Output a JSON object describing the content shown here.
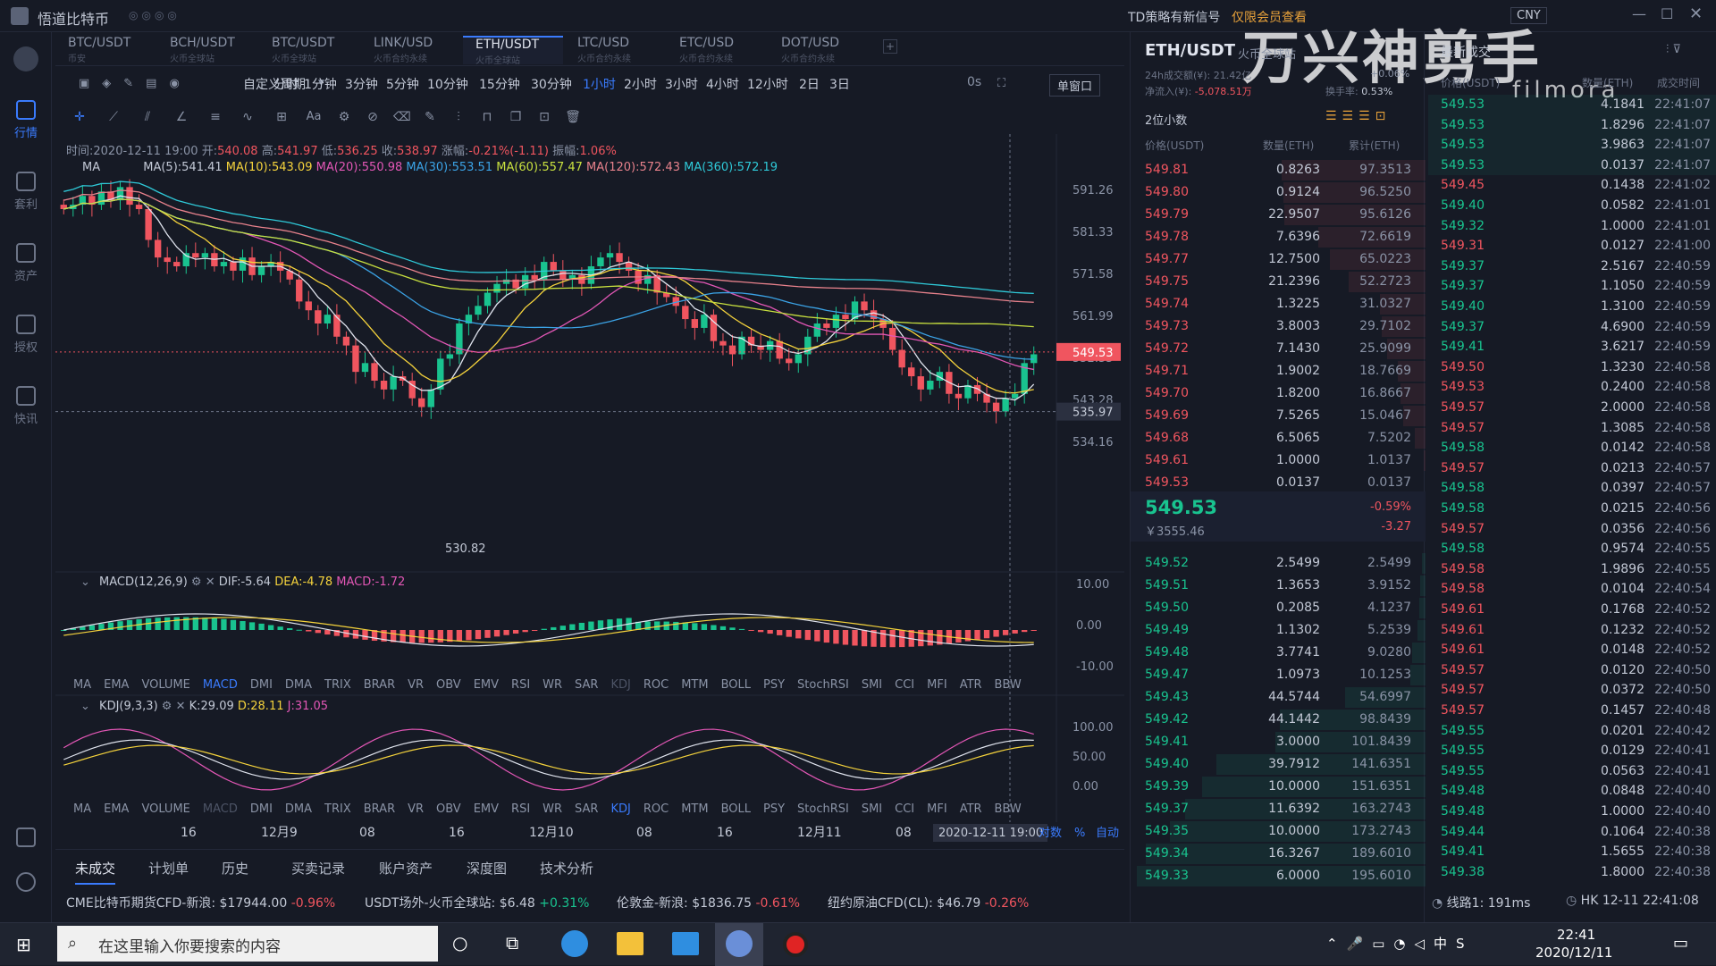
{
  "app": {
    "title": "悟道比特币",
    "notice": "TD策略有新信号",
    "notice_link": "仅限会员查看",
    "currency": "CNY"
  },
  "nav": [
    {
      "label": "行情",
      "icon": "market-icon",
      "active": true
    },
    {
      "label": "套利",
      "icon": "arbitrage-icon"
    },
    {
      "label": "资产",
      "icon": "wallet-icon"
    },
    {
      "label": "授权",
      "icon": "auth-icon"
    },
    {
      "label": "快讯",
      "icon": "news-icon"
    }
  ],
  "tabs": [
    {
      "pair": "BTC/USDT",
      "sub": "币安"
    },
    {
      "pair": "BCH/USDT",
      "sub": "火币全球站"
    },
    {
      "pair": "BTC/USDT",
      "sub": "火币全球站"
    },
    {
      "pair": "LINK/USD",
      "sub": "火币合约永续"
    },
    {
      "pair": "ETH/USDT",
      "sub": "火币全球站",
      "active": true
    },
    {
      "pair": "LTC/USD",
      "sub": "火币合约永续"
    },
    {
      "pair": "ETC/USD",
      "sub": "火币合约永续"
    },
    {
      "pair": "DOT/USD",
      "sub": "火币合约永续"
    }
  ],
  "periods": {
    "custom": "自定义周期",
    "items": [
      "分时",
      "1分钟",
      "3分钟",
      "5分钟",
      "10分钟",
      "15分钟",
      "30分钟",
      "1小时",
      "2小时",
      "3小时",
      "4小时",
      "12小时",
      "2日",
      "3日"
    ],
    "active": "1小时",
    "right_label": "0s",
    "window": "单窗口"
  },
  "info": {
    "time_label": "时间:",
    "time": "2020-12-11 19:00",
    "open_label": "开:",
    "open": "540.08",
    "high_label": "高:",
    "high": "541.97",
    "low_label": "低:",
    "low": "536.25",
    "close_label": "收:",
    "close": "538.97",
    "chg_label": "涨幅:",
    "chg": "-0.21%(-1.11)",
    "amp_label": "振幅:",
    "amp": "1.06%"
  },
  "ma": {
    "label": "MA",
    "ma5": "MA(5):541.41",
    "ma10": "MA(10):543.09",
    "ma20": "MA(20):550.98",
    "ma30": "MA(30):553.51",
    "ma60": "MA(60):557.47",
    "ma120": "MA(120):572.43",
    "ma360": "MA(360):572.19"
  },
  "price_axis": [
    "591.26",
    "581.33",
    "571.58",
    "561.99",
    "552.55",
    "543.28",
    "534.16"
  ],
  "last_price_tag": "549.53",
  "cross_price_tag": "535.97",
  "low_marker": "530.82",
  "macd": {
    "label": "MACD(12,26,9)",
    "dif": "DIF:-5.64",
    "dea": "DEA:-4.78",
    "macd": "MACD:-1.72",
    "axis": [
      "10.00",
      "0.00",
      "-10.00"
    ]
  },
  "kdj": {
    "label": "KDJ(9,3,3)",
    "k": "K:29.09",
    "d": "D:28.11",
    "j": "J:31.05",
    "axis": [
      "100.00",
      "50.00",
      "0.00"
    ]
  },
  "indicators": [
    "MA",
    "EMA",
    "VOLUME",
    "MACD",
    "DMI",
    "DMA",
    "TRIX",
    "BRAR",
    "VR",
    "OBV",
    "EMV",
    "RSI",
    "WR",
    "SAR",
    "KDJ",
    "ROC",
    "MTM",
    "BOLL",
    "PSY",
    "StochRSI",
    "SMI",
    "CCI",
    "MFI",
    "ATR",
    "BBW"
  ],
  "time_axis": [
    "16",
    "12月9",
    "08",
    "16",
    "12月10",
    "08",
    "16",
    "12月11",
    "08"
  ],
  "time_cursor": "2020-12-11 19:00",
  "axis_opts": [
    "对数",
    "%",
    "自动"
  ],
  "bottom_tabs": [
    "未成交",
    "计划单",
    "历史",
    "买卖记录",
    "账户资产",
    "深度图",
    "技术分析"
  ],
  "ticker": [
    {
      "name": "CME比特币期货CFD-新浪:",
      "price": "$17944.00",
      "chg": "-0.96%"
    },
    {
      "name": "USDT场外-火币全球站:",
      "price": "$6.48",
      "chg": "+0.31%"
    },
    {
      "name": "伦敦金-新浪:",
      "price": "$1836.75",
      "chg": "-0.61%"
    },
    {
      "name": "纽约原油CFD(CL):",
      "price": "$46.79",
      "chg": "-0.26%"
    }
  ],
  "status": {
    "line": "线路1: 191ms",
    "clock": "HK 12-11 22:41:08"
  },
  "summary": {
    "pair": "ETH/USDT",
    "exchange": "火币全球站",
    "vol_label": "24h成交额(¥):",
    "vol": "21.42亿",
    "inflow_label": "净流入(¥):",
    "inflow": "-5,078.51万",
    "chg": "+0.06%",
    "turnover_label": "换手率:",
    "turnover": "0.53%"
  },
  "orderbook": {
    "decimals": "2位小数",
    "headers": [
      "价格(USDT)",
      "数量(ETH)",
      "累计(ETH)"
    ],
    "asks": [
      [
        "549.81",
        "0.8263",
        "97.3513"
      ],
      [
        "549.80",
        "0.9124",
        "96.5250"
      ],
      [
        "549.79",
        "22.9507",
        "95.6126"
      ],
      [
        "549.78",
        "7.6396",
        "72.6619"
      ],
      [
        "549.77",
        "12.7500",
        "65.0223"
      ],
      [
        "549.75",
        "21.2396",
        "52.2723"
      ],
      [
        "549.74",
        "1.3225",
        "31.0327"
      ],
      [
        "549.73",
        "3.8003",
        "29.7102"
      ],
      [
        "549.72",
        "7.1430",
        "25.9099"
      ],
      [
        "549.71",
        "1.9002",
        "18.7669"
      ],
      [
        "549.70",
        "1.8200",
        "16.8667"
      ],
      [
        "549.69",
        "7.5265",
        "15.0467"
      ],
      [
        "549.68",
        "6.5065",
        "7.5202"
      ],
      [
        "549.61",
        "1.0000",
        "1.0137"
      ],
      [
        "549.53",
        "0.0137",
        "0.0137"
      ]
    ],
    "mid_price": "549.53",
    "mid_cny": "￥3555.46",
    "mid_chg": "-0.59%",
    "mid_diff": "-3.27",
    "bids": [
      [
        "549.52",
        "2.5499",
        "2.5499"
      ],
      [
        "549.51",
        "1.3653",
        "3.9152"
      ],
      [
        "549.50",
        "0.2085",
        "4.1237"
      ],
      [
        "549.49",
        "1.1302",
        "5.2539"
      ],
      [
        "549.48",
        "3.7741",
        "9.0280"
      ],
      [
        "549.47",
        "1.0973",
        "10.1253"
      ],
      [
        "549.43",
        "44.5744",
        "54.6997"
      ],
      [
        "549.42",
        "44.1442",
        "98.8439"
      ],
      [
        "549.41",
        "3.0000",
        "101.8439"
      ],
      [
        "549.40",
        "39.7912",
        "141.6351"
      ],
      [
        "549.39",
        "10.0000",
        "151.6351"
      ],
      [
        "549.37",
        "11.6392",
        "163.2743"
      ],
      [
        "549.35",
        "10.0000",
        "173.2743"
      ],
      [
        "549.34",
        "16.3267",
        "189.6010"
      ],
      [
        "549.33",
        "6.0000",
        "195.6010"
      ]
    ]
  },
  "trades": {
    "title": "最新成交",
    "headers": [
      "价格(USDT)",
      "数量(ETH)",
      "成交时间"
    ],
    "rows": [
      [
        "549.53",
        "4.1841",
        "22:41:07",
        "g"
      ],
      [
        "549.53",
        "1.8296",
        "22:41:07",
        "g"
      ],
      [
        "549.53",
        "3.9863",
        "22:41:07",
        "g"
      ],
      [
        "549.53",
        "0.0137",
        "22:41:07",
        "g"
      ],
      [
        "549.45",
        "0.1438",
        "22:41:02",
        "r"
      ],
      [
        "549.40",
        "0.0582",
        "22:41:01",
        "g"
      ],
      [
        "549.32",
        "1.0000",
        "22:41:01",
        "g"
      ],
      [
        "549.31",
        "0.0127",
        "22:41:00",
        "r"
      ],
      [
        "549.37",
        "2.5167",
        "22:40:59",
        "g"
      ],
      [
        "549.37",
        "1.1050",
        "22:40:59",
        "g"
      ],
      [
        "549.40",
        "1.3100",
        "22:40:59",
        "g"
      ],
      [
        "549.37",
        "4.6900",
        "22:40:59",
        "g"
      ],
      [
        "549.41",
        "3.6217",
        "22:40:59",
        "g"
      ],
      [
        "549.50",
        "1.3230",
        "22:40:58",
        "r"
      ],
      [
        "549.53",
        "0.2400",
        "22:40:58",
        "r"
      ],
      [
        "549.57",
        "2.0000",
        "22:40:58",
        "r"
      ],
      [
        "549.57",
        "1.3085",
        "22:40:58",
        "r"
      ],
      [
        "549.58",
        "0.0142",
        "22:40:58",
        "g"
      ],
      [
        "549.57",
        "0.0213",
        "22:40:57",
        "r"
      ],
      [
        "549.58",
        "0.0397",
        "22:40:57",
        "g"
      ],
      [
        "549.58",
        "0.0215",
        "22:40:56",
        "g"
      ],
      [
        "549.57",
        "0.0356",
        "22:40:56",
        "r"
      ],
      [
        "549.58",
        "0.9574",
        "22:40:55",
        "g"
      ],
      [
        "549.58",
        "1.9896",
        "22:40:55",
        "r"
      ],
      [
        "549.58",
        "0.0104",
        "22:40:54",
        "r"
      ],
      [
        "549.61",
        "0.1768",
        "22:40:52",
        "r"
      ],
      [
        "549.61",
        "0.1232",
        "22:40:52",
        "r"
      ],
      [
        "549.61",
        "0.0148",
        "22:40:52",
        "r"
      ],
      [
        "549.57",
        "0.0120",
        "22:40:50",
        "r"
      ],
      [
        "549.57",
        "0.0372",
        "22:40:50",
        "r"
      ],
      [
        "549.57",
        "0.1457",
        "22:40:48",
        "r"
      ],
      [
        "549.55",
        "0.0201",
        "22:40:42",
        "g"
      ],
      [
        "549.55",
        "0.0129",
        "22:40:41",
        "g"
      ],
      [
        "549.55",
        "0.0563",
        "22:40:41",
        "g"
      ],
      [
        "549.48",
        "0.0848",
        "22:40:40",
        "g"
      ],
      [
        "549.48",
        "1.0000",
        "22:40:40",
        "g"
      ],
      [
        "549.44",
        "0.1064",
        "22:40:38",
        "g"
      ],
      [
        "549.41",
        "1.5655",
        "22:40:38",
        "g"
      ],
      [
        "549.38",
        "1.8000",
        "22:40:38",
        "g"
      ]
    ]
  },
  "taskbar": {
    "search_placeholder": "在这里输入你要搜索的内容",
    "time": "22:41",
    "date": "2020/12/11"
  },
  "watermark": {
    "brand": "万兴神剪手",
    "sub": "filmora"
  },
  "colors": {
    "up": "#19c38f",
    "down": "#f0555f",
    "accent": "#3a7bfd"
  }
}
